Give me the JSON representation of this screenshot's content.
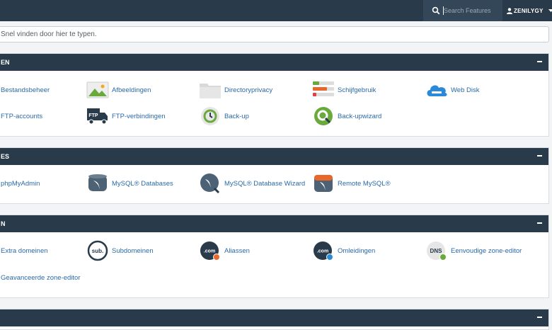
{
  "topbar": {
    "search": {
      "placeholder": "Search Features"
    },
    "user": {
      "name": "ZENILYGY"
    }
  },
  "filter": {
    "placeholder": "Snel vinden door hier te typen."
  },
  "panels": [
    {
      "title": "BESTANDEN",
      "visible_title": "EN",
      "items": [
        {
          "label": "Bestandsbeheer",
          "icon": "file-manager-icon"
        },
        {
          "label": "Afbeeldingen",
          "icon": "images-icon"
        },
        {
          "label": "Directoryprivacy",
          "icon": "folder-privacy-icon"
        },
        {
          "label": "Schijfgebruik",
          "icon": "disk-usage-icon"
        },
        {
          "label": "Web Disk",
          "icon": "cloud-disk-icon"
        },
        {
          "label": "FTP-accounts",
          "icon": "ftp-accounts-icon"
        },
        {
          "label": "FTP-verbindingen",
          "icon": "ftp-truck-icon"
        },
        {
          "label": "Back-up",
          "icon": "backup-icon"
        },
        {
          "label": "Back-upwizard",
          "icon": "backup-wizard-icon"
        }
      ]
    },
    {
      "title": "DATABASES",
      "visible_title": "ES",
      "items": [
        {
          "label": "phpMyAdmin",
          "icon": "phpmyadmin-icon"
        },
        {
          "label": "MySQL® Databases",
          "icon": "mysql-database-icon"
        },
        {
          "label": "MySQL® Database Wizard",
          "icon": "mysql-wizard-icon"
        },
        {
          "label": "Remote MySQL®",
          "icon": "remote-mysql-icon"
        }
      ]
    },
    {
      "title": "DOMEINEN",
      "visible_title": "N",
      "items": [
        {
          "label": "Extra domeinen",
          "icon": "addon-domains-icon"
        },
        {
          "label": "Subdomeinen",
          "icon": "subdomains-icon",
          "badge": "sub."
        },
        {
          "label": "Aliassen",
          "icon": "aliases-icon",
          "badge": ".com"
        },
        {
          "label": "Omleidingen",
          "icon": "redirects-icon",
          "badge": ".com"
        },
        {
          "label": "Eenvoudige zone-editor",
          "icon": "dns-icon",
          "badge": "DNS"
        },
        {
          "label": "Geavanceerde zone-editor",
          "icon": "advanced-dns-icon"
        }
      ]
    }
  ],
  "colors": {
    "header": "#293a4a",
    "link": "#2a6aa8",
    "green": "#6aaa3c",
    "orange": "#e8682c",
    "blue": "#2a8ad8"
  }
}
